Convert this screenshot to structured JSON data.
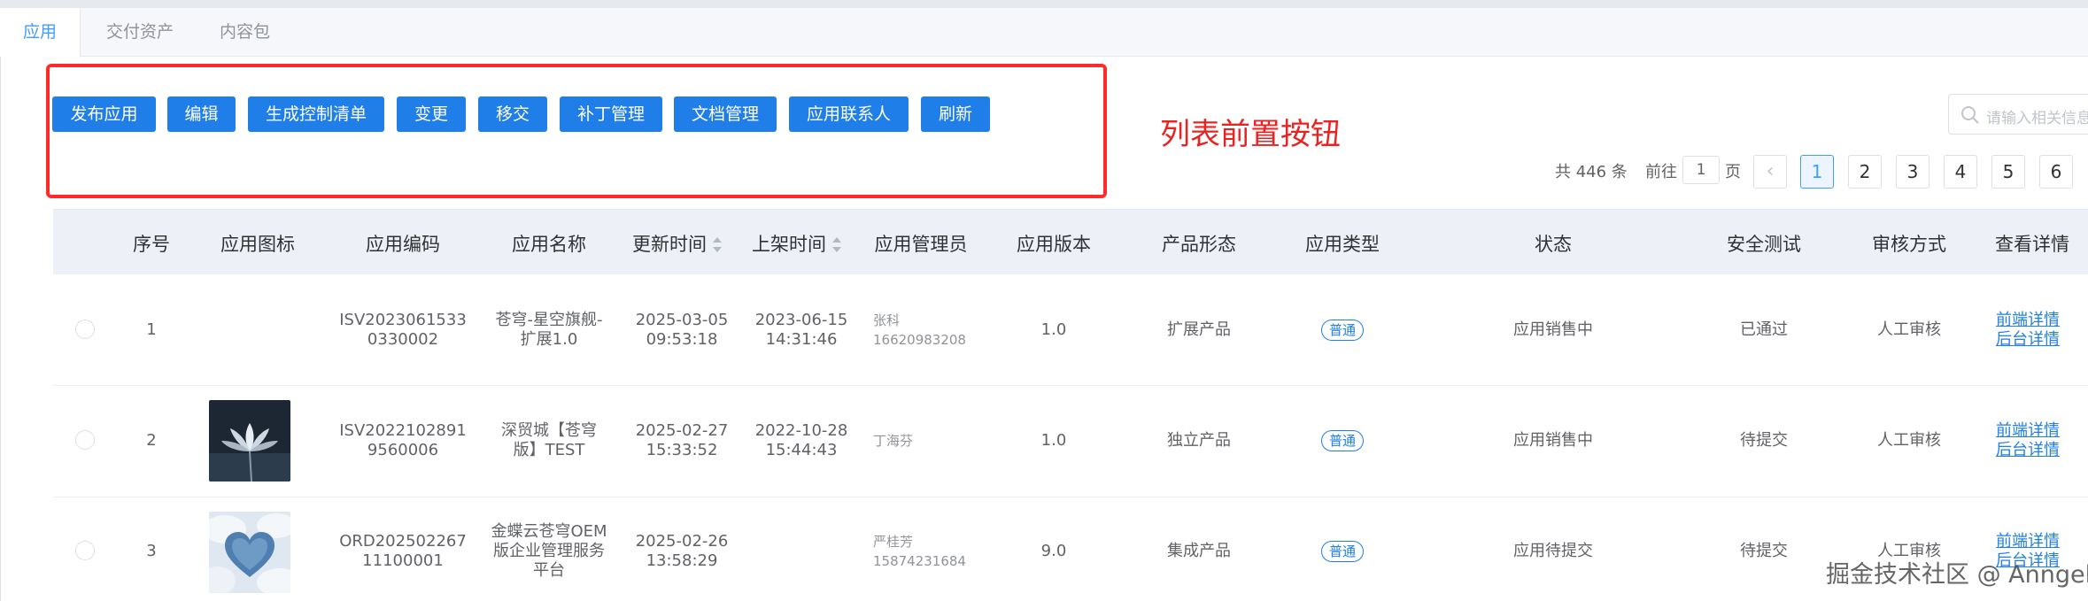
{
  "tabs": [
    {
      "label": "应用",
      "active": true
    },
    {
      "label": "交付资产",
      "active": false
    },
    {
      "label": "内容包",
      "active": false
    }
  ],
  "toolbar": {
    "buttons": [
      "发布应用",
      "编辑",
      "生成控制清单",
      "变更",
      "移交",
      "补丁管理",
      "文档管理",
      "应用联系人",
      "刷新"
    ]
  },
  "annotation": "列表前置按钮",
  "search": {
    "placeholder": "请输入相关信息"
  },
  "pagination": {
    "total": "共 446 条",
    "goto_prefix": "前往",
    "goto_value": "1",
    "goto_suffix": "页",
    "prev": "‹",
    "pages": [
      "1",
      "2",
      "3",
      "4",
      "5",
      "6"
    ],
    "current": "1"
  },
  "table": {
    "columns": [
      "序号",
      "应用图标",
      "应用编码",
      "应用名称",
      "更新时间",
      "上架时间",
      "应用管理员",
      "应用版本",
      "产品形态",
      "应用类型",
      "状态",
      "安全测试",
      "审核方式",
      "查看详情"
    ],
    "rows": [
      {
        "index": "1",
        "code": [
          "ISV2023061533",
          "0330002"
        ],
        "name": [
          "苍穹-星空旗舰-",
          "扩展1.0"
        ],
        "updated": [
          "2025-03-05",
          "09:53:18"
        ],
        "listed": [
          "2023-06-15",
          "14:31:46"
        ],
        "admin": "张科",
        "admin_phone": "16620983208",
        "version": "1.0",
        "form": "扩展产品",
        "type": "普通",
        "status": "应用销售中",
        "security": "已通过",
        "review": "人工审核",
        "links": [
          "前端详情",
          "后台详情"
        ]
      },
      {
        "index": "2",
        "code": [
          "ISV2022102891",
          "9560006"
        ],
        "name": [
          "深贸城【苍穹",
          "版】TEST"
        ],
        "updated": [
          "2025-02-27",
          "15:33:52"
        ],
        "listed": [
          "2022-10-28",
          "15:44:43"
        ],
        "admin": "丁海芬",
        "admin_phone": "",
        "version": "1.0",
        "form": "独立产品",
        "type": "普通",
        "status": "应用销售中",
        "security": "待提交",
        "review": "人工审核",
        "links": [
          "前端详情",
          "后台详情"
        ]
      },
      {
        "index": "3",
        "code": [
          "ORD202502267",
          "11100001"
        ],
        "name": [
          "金蝶云苍穹OEM",
          "版企业管理服务",
          "平台"
        ],
        "updated": [
          "2025-02-26",
          "13:58:29"
        ],
        "listed": [
          "",
          ""
        ],
        "admin": "严桂芳",
        "admin_phone": "15874231684",
        "version": "9.0",
        "form": "集成产品",
        "type": "普通",
        "status": "应用待提交",
        "security": "待提交",
        "review": "人工审核",
        "links": [
          "前端详情",
          "后台详情"
        ]
      }
    ]
  },
  "watermark": "掘金技术社区 @ Anngel"
}
